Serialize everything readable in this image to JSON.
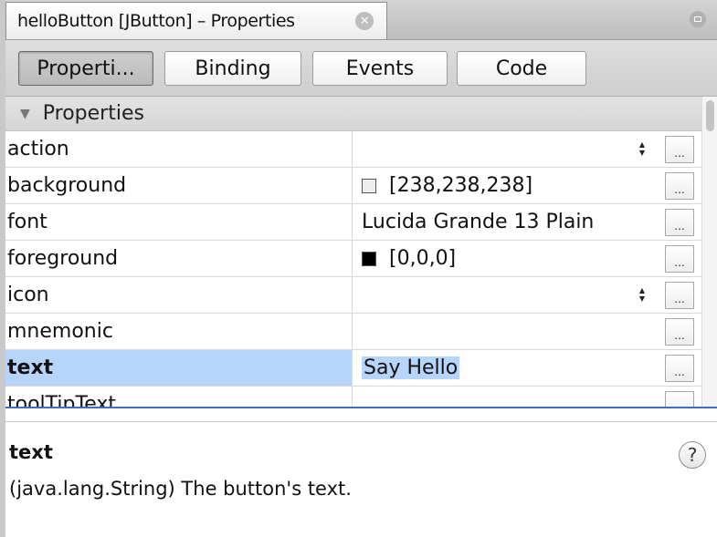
{
  "window": {
    "tab_title": "helloButton [JButton] – Properties",
    "close_icon": "x-circle-icon",
    "menu_icon": "window-menu-icon"
  },
  "section_buttons": [
    {
      "label": "Properti...",
      "active": true
    },
    {
      "label": "Binding",
      "active": false
    },
    {
      "label": "Events",
      "active": false
    },
    {
      "label": "Code",
      "active": false
    }
  ],
  "sheet": {
    "section_label": "Properties",
    "rows": [
      {
        "name": "action",
        "value": "",
        "spinner": true
      },
      {
        "name": "background",
        "value": "[238,238,238]",
        "swatch": "#eeeeee"
      },
      {
        "name": "font",
        "value": "Lucida Grande 13 Plain"
      },
      {
        "name": "foreground",
        "value": "[0,0,0]",
        "swatch": "#000000"
      },
      {
        "name": "icon",
        "value": "",
        "spinner": true
      },
      {
        "name": "mnemonic",
        "value": ""
      },
      {
        "name": "text",
        "value": "Say Hello",
        "selected": true
      },
      {
        "name": "toolTipText",
        "value": ""
      }
    ],
    "ellipsis_label": "..."
  },
  "help": {
    "title": "text",
    "description": "(java.lang.String) The button's text.",
    "help_label": "?"
  }
}
